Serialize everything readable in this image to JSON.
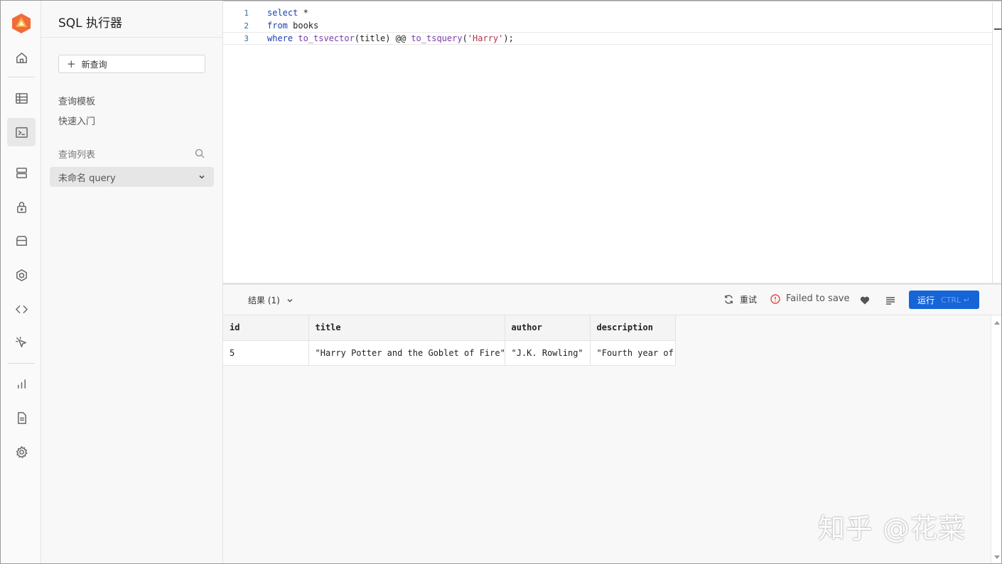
{
  "sidebar_rail": {
    "items": [
      {
        "icon": "home-icon"
      },
      {
        "icon": "table-icon"
      },
      {
        "icon": "terminal-icon"
      },
      {
        "icon": "database-icon"
      },
      {
        "icon": "lock-icon"
      },
      {
        "icon": "storage-icon"
      },
      {
        "icon": "cube-icon"
      },
      {
        "icon": "code-icon"
      },
      {
        "icon": "cursor-icon"
      },
      {
        "icon": "bar-chart-icon"
      },
      {
        "icon": "document-icon"
      },
      {
        "icon": "gear-icon"
      }
    ]
  },
  "panel": {
    "title": "SQL 执行器",
    "new_query_label": "新查询",
    "links": [
      "查询模板",
      "快速入门"
    ],
    "list_title": "查询列表",
    "query_item": "未命名 query"
  },
  "editor": {
    "lines": [
      {
        "num": "1",
        "parts": [
          {
            "t": "select",
            "c": "kw"
          },
          {
            "t": " *",
            "c": ""
          }
        ]
      },
      {
        "num": "2",
        "parts": [
          {
            "t": "from",
            "c": "kw"
          },
          {
            "t": " books",
            "c": ""
          }
        ]
      },
      {
        "num": "3",
        "parts": [
          {
            "t": "where",
            "c": "kw"
          },
          {
            "t": " ",
            "c": ""
          },
          {
            "t": "to_tsvector",
            "c": "fn"
          },
          {
            "t": "(title) @@ ",
            "c": ""
          },
          {
            "t": "to_tsquery",
            "c": "fn"
          },
          {
            "t": "(",
            "c": ""
          },
          {
            "t": "'Harry'",
            "c": "str"
          },
          {
            "t": ");",
            "c": ""
          }
        ]
      }
    ]
  },
  "results_bar": {
    "tab_label": "结果 (1)",
    "retry_label": "重试",
    "status": "Failed to save",
    "run_label": "运行",
    "run_hint": "CTRL ↵"
  },
  "grid": {
    "columns": [
      "id",
      "title",
      "author",
      "description"
    ],
    "rows": [
      [
        "5",
        "\"Harry Potter and the Goblet of Fire\"",
        "\"J.K. Rowling\"",
        "\"Fourth year of"
      ]
    ]
  },
  "watermark": "知乎 @花菜"
}
